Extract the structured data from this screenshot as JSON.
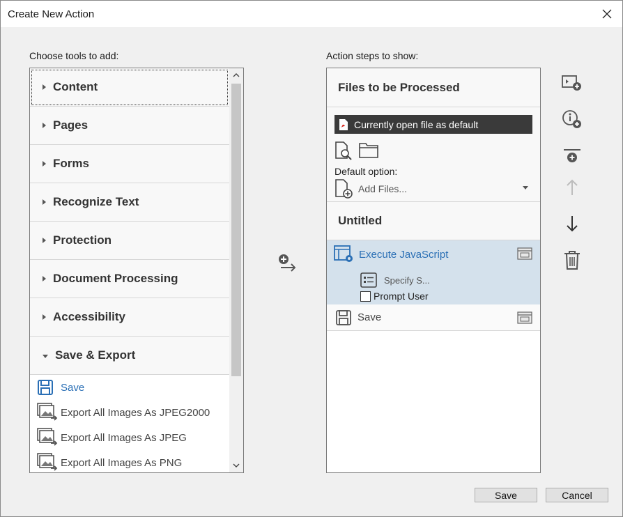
{
  "window": {
    "title": "Create New Action"
  },
  "left_panel": {
    "label": "Choose tools to add:",
    "categories": [
      {
        "label": "Content"
      },
      {
        "label": "Pages"
      },
      {
        "label": "Forms"
      },
      {
        "label": "Recognize Text"
      },
      {
        "label": "Protection"
      },
      {
        "label": "Document Processing"
      },
      {
        "label": "Accessibility"
      },
      {
        "label": "Save & Export"
      }
    ],
    "tools": [
      {
        "label": "Save",
        "icon": "save-icon"
      },
      {
        "label": "Export All Images As JPEG2000",
        "icon": "export-images-icon"
      },
      {
        "label": "Export All Images As JPEG",
        "icon": "export-images-icon"
      },
      {
        "label": "Export All Images As PNG",
        "icon": "export-images-icon"
      }
    ]
  },
  "right_panel": {
    "label": "Action steps to show:",
    "files_header": "Files to be Processed",
    "file_source": "Currently open file as default",
    "default_option_label": "Default option:",
    "add_files_label": "Add Files...",
    "group_title": "Untitled",
    "steps": {
      "execute": "Execute JavaScript",
      "specify": "Specify S...",
      "prompt_user": "Prompt User",
      "save": "Save"
    }
  },
  "side_tools": [
    {
      "icon": "add-instruction-step-icon"
    },
    {
      "icon": "add-info-icon"
    },
    {
      "icon": "add-panel-separator-icon"
    },
    {
      "icon": "move-up-icon"
    },
    {
      "icon": "move-down-icon"
    },
    {
      "icon": "delete-icon"
    }
  ],
  "footer": {
    "save_label": "Save",
    "cancel_label": "Cancel"
  },
  "colors": {
    "accent_blue": "#2a6fb5",
    "selected_bg": "#d4e1ec",
    "dark_dropdown": "#3a3a3a"
  }
}
